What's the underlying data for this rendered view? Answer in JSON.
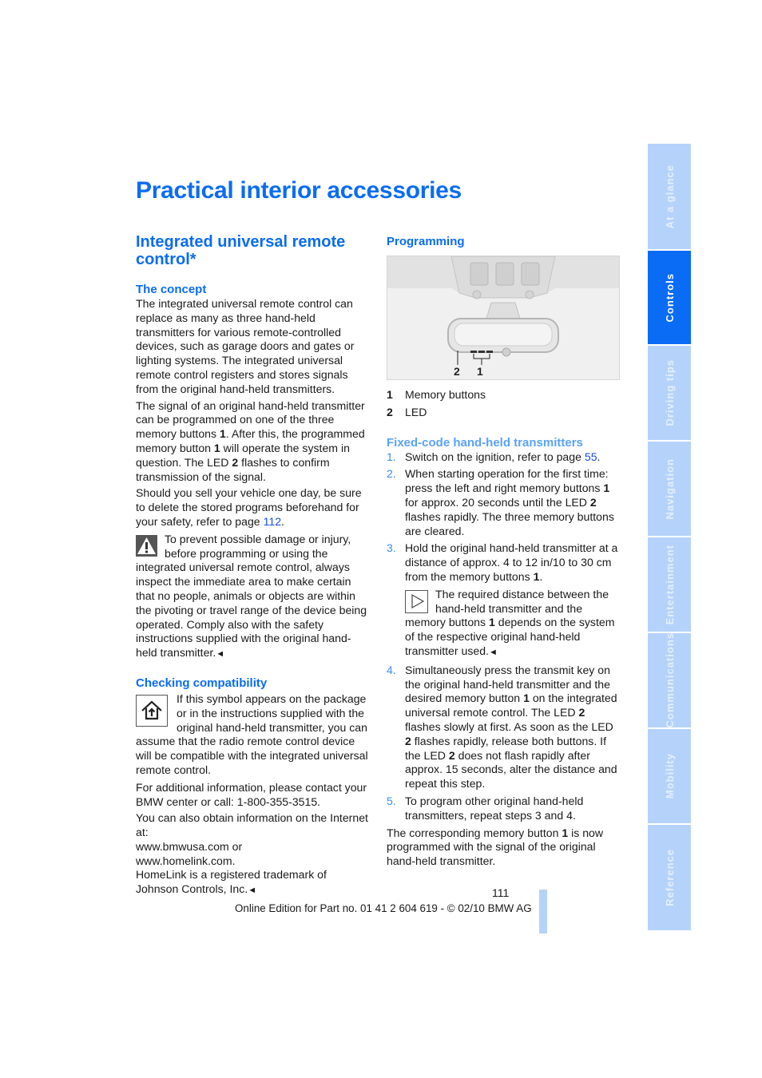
{
  "page_title": "Practical interior accessories",
  "left_column": {
    "section_title": "Integrated universal remote control*",
    "concept": {
      "heading": "The concept",
      "para1": "The integrated universal remote control can replace as many as three hand-held transmitters for various remote-controlled devices, such as garage doors and gates or lighting systems. The integrated universal remote control registers and stores signals from the original hand-held transmitters.",
      "para2_a": "The signal of an original hand-held transmitter can be programmed on one of the three memory buttons ",
      "para2_b": "1",
      "para2_c": ". After this, the programmed memory button ",
      "para2_d": "1",
      "para2_e": " will operate the system in question. The LED ",
      "para2_f": "2",
      "para2_g": " flashes to confirm transmission of the signal.",
      "para3_a": "Should you sell your vehicle one day, be sure to delete the stored programs beforehand for your safety, refer to page ",
      "para3_link": "112",
      "para3_b": ".",
      "warning_icon": "warning-triangle-icon",
      "warning_text": "To prevent possible damage or injury, before programming or using the integrated universal remote control, always inspect the immediate area to make certain that no people, animals or objects are within the pivoting or travel range of the device being operated. Comply also with the safety instructions supplied with the original hand-held transmitter.",
      "end_mark": "◄"
    },
    "compatibility": {
      "heading": "Checking compatibility",
      "symbol_icon": "homelink-house-icon",
      "para1": "If this symbol appears on the package or in the instructions supplied with the original hand-held transmitter, you can assume that the radio remote control device will be compatible with the integrated universal remote control.",
      "para2": "For additional information, please contact your BMW center or call: 1-800-355-3515.",
      "para3": "You can also obtain information on the Internet at:",
      "url1": "www.bmwusa.com or",
      "url2": "www.homelink.com.",
      "para4": "HomeLink is a registered trademark of Johnson Controls, Inc.",
      "end_mark": "◄"
    }
  },
  "right_column": {
    "programming_heading": "Programming",
    "figure": {
      "label_2": "2",
      "label_1": "1"
    },
    "legend": [
      {
        "num": "1",
        "label": "Memory buttons"
      },
      {
        "num": "2",
        "label": "LED"
      }
    ],
    "fixed_code_heading": "Fixed-code hand-held transmitters",
    "steps": [
      {
        "num": "1.",
        "text_a": "Switch on the ignition, refer to page ",
        "link": "55",
        "text_b": "."
      },
      {
        "num": "2.",
        "text": "When starting operation for the first time: press the left and right memory buttons 1 for approx. 20 seconds until the LED 2 flashes rapidly. The three memory buttons are cleared."
      },
      {
        "num": "3.",
        "text": "Hold the original hand-held transmitter at a distance of approx. 4 to 12 in/10 to 30 cm from the memory buttons 1."
      },
      {
        "num": "4.",
        "text": "Simultaneously press the transmit key on the original hand-held transmitter and the desired memory button 1 on the integrated universal remote control. The LED 2 flashes slowly at first. As soon as the LED 2 flashes rapidly, release both buttons. If the LED 2 does not flash rapidly after approx. 15 seconds, alter the distance and repeat this step."
      },
      {
        "num": "5.",
        "text": "To program other original hand-held transmitters, repeat steps 3 and 4."
      }
    ],
    "note_icon": "note-arrow-icon",
    "note_text": "The required distance between the hand-held transmitter and the memory buttons 1 depends on the system of the respective original hand-held transmitter used.",
    "note_end_mark": "◄",
    "closing_text": "The corresponding memory button 1 is now programmed with the signal of the original hand-held transmitter."
  },
  "sidebar": {
    "tabs": [
      {
        "label": "At a glance",
        "active": false
      },
      {
        "label": "Controls",
        "active": true
      },
      {
        "label": "Driving tips",
        "active": false
      },
      {
        "label": "Navigation",
        "active": false
      },
      {
        "label": "Entertainment",
        "active": false
      },
      {
        "label": "Communications",
        "active": false
      },
      {
        "label": "Mobility",
        "active": false
      },
      {
        "label": "Reference",
        "active": false
      }
    ]
  },
  "footer": {
    "page_number": "111",
    "edition_text": "Online Edition for Part no. 01 41 2 604 619 - © 02/10 BMW AG"
  },
  "colors": {
    "heading_blue": "#0a6cf5",
    "tab_active": "#0a6cf5",
    "tab_inactive": "#b5d3fa"
  }
}
